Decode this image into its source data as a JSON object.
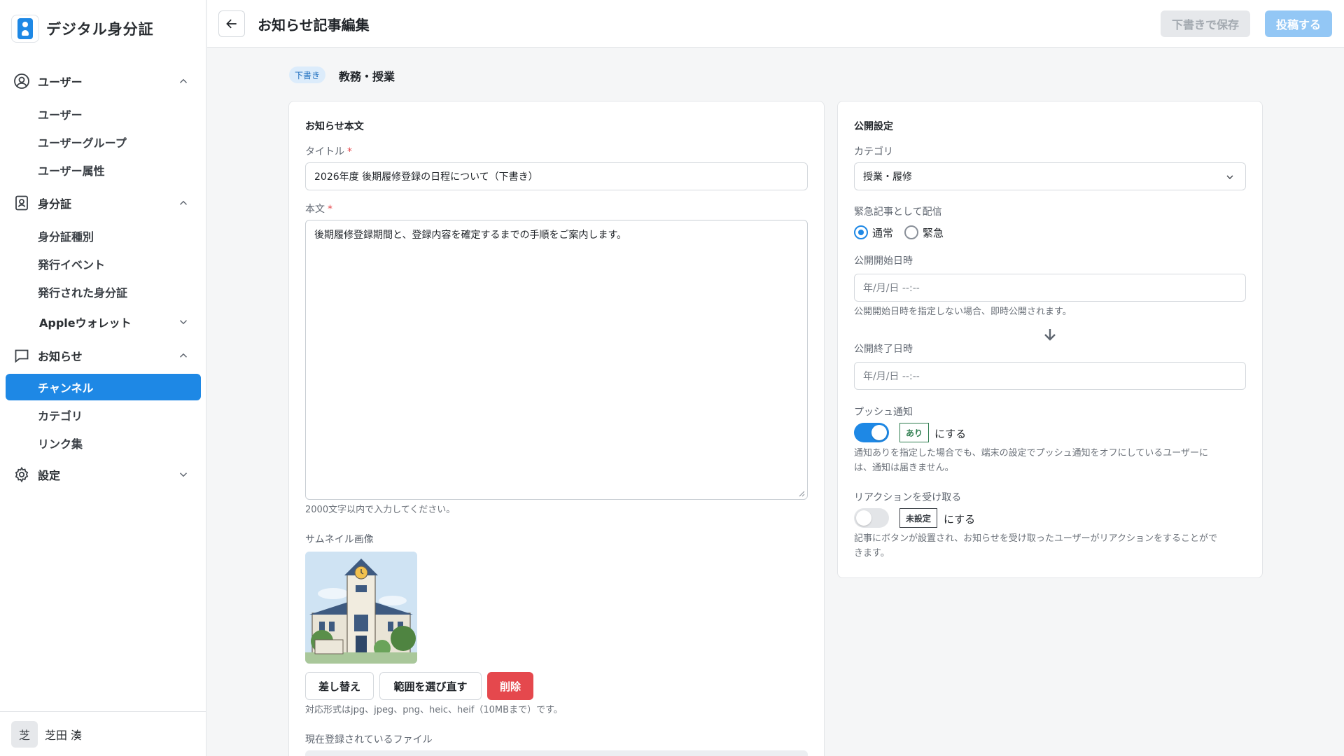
{
  "app": {
    "name": "デジタル身分証"
  },
  "sidebar": {
    "groups": [
      {
        "label": "ユーザー",
        "items": [
          "ユーザー",
          "ユーザーグループ",
          "ユーザー属性"
        ]
      },
      {
        "label": "身分証",
        "items": [
          "身分証種別",
          "発行イベント",
          "発行された身分証"
        ],
        "sub": "Appleウォレット"
      },
      {
        "label": "お知らせ",
        "items": [
          "チャンネル",
          "カテゴリ",
          "リンク集"
        ]
      },
      {
        "label": "設定"
      }
    ],
    "active_item": "チャンネル"
  },
  "user": {
    "avatar_initial": "芝",
    "name": "芝田 湊"
  },
  "header": {
    "title": "お知らせ記事編集",
    "save_draft_label": "下書きで保存",
    "post_label": "投稿する"
  },
  "status": {
    "badge": "下書き",
    "category": "教務・授業"
  },
  "content": {
    "section_title": "お知らせ本文",
    "title_label": "タイトル",
    "required_mark": "*",
    "title_value": "2026年度 後期履修登録の日程について（下書き）",
    "body_label": "本文",
    "body_value": "後期履修登録期間と、登録内容を確定するまでの手順をご案内します。",
    "body_help": "2000文字以内で入力してください。",
    "thumbnail_label": "サムネイル画像",
    "replace_label": "差し替え",
    "reselect_label": "範囲を選び直す",
    "delete_label": "削除",
    "format_help": "対応形式はjpg、jpeg、png、heic、heif（10MBまで）です。",
    "files_label": "現在登録されているファイル"
  },
  "publish": {
    "section_title": "公開設定",
    "category_label": "カテゴリ",
    "category_value": "授業・履修",
    "urgent_label": "緊急記事として配信",
    "radio_normal": "通常",
    "radio_urgent": "緊急",
    "start_label": "公開開始日時",
    "start_placeholder": "年/月/日 --:--",
    "start_help": "公開開始日時を指定しない場合、即時公開されます。",
    "end_label": "公開終了日時",
    "end_placeholder": "年/月/日 --:--",
    "push_label": "プッシュ通知",
    "push_tag": "あり",
    "push_suffix": "にする",
    "push_help_1": "通知ありを指定した場合でも、端末の設定でプッシュ通知をオフにしているユーザーに",
    "push_help_2": "は、通知は届きません。",
    "reaction_label": "リアクションを受け取る",
    "reaction_tag": "未設定",
    "reaction_suffix": "にする",
    "reaction_help_1": "記事にボタンが設置され、お知らせを受け取ったユーザーがリアクションをすることがで",
    "reaction_help_2": "きます。"
  },
  "colors": {
    "primary": "#1e88e5",
    "danger": "#e5484d",
    "success": "#2e7d4f"
  }
}
